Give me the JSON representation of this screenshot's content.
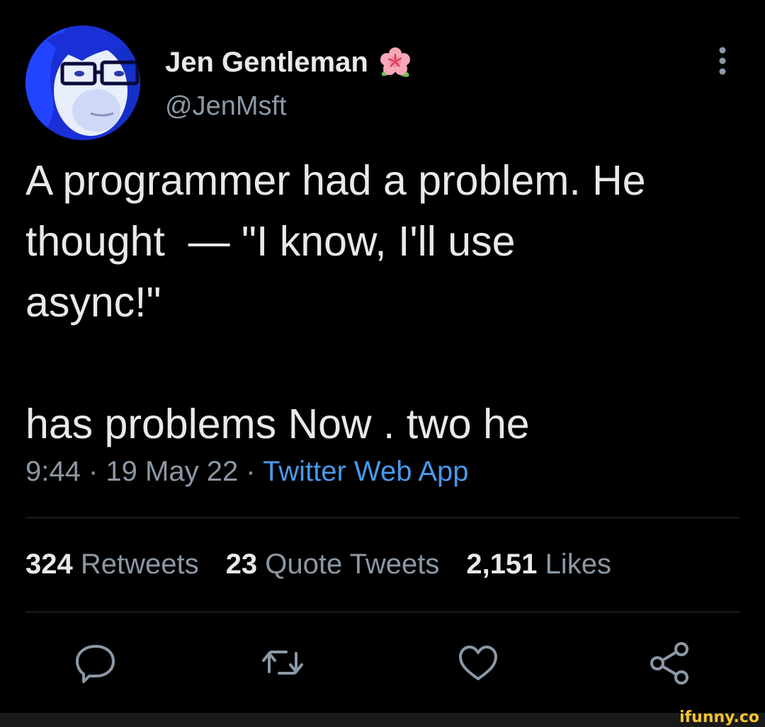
{
  "author": {
    "display_name": "Jen Gentleman",
    "handle": "@JenMsft",
    "badge_icon": "flower-emoji"
  },
  "tweet": {
    "text": "A programmer had a problem. He\nthought  — \"I know, I'll use\nasync!\"\n\nhas problems Now . two he",
    "time": "9:44",
    "date": "19 May 22",
    "source": "Twitter Web App",
    "separator": " · "
  },
  "stats": [
    {
      "count": "324",
      "label": "Retweets"
    },
    {
      "count": "23",
      "label": "Quote Tweets"
    },
    {
      "count": "2,151",
      "label": "Likes"
    }
  ],
  "actions": [
    "reply-icon",
    "retweet-icon",
    "like-icon",
    "share-icon"
  ],
  "colors": {
    "background": "#000000",
    "text": "#e7e9ea",
    "secondary": "#8b98a5",
    "link": "#4a99e9",
    "divider": "#2f3336"
  },
  "watermark": "ifunny.co"
}
